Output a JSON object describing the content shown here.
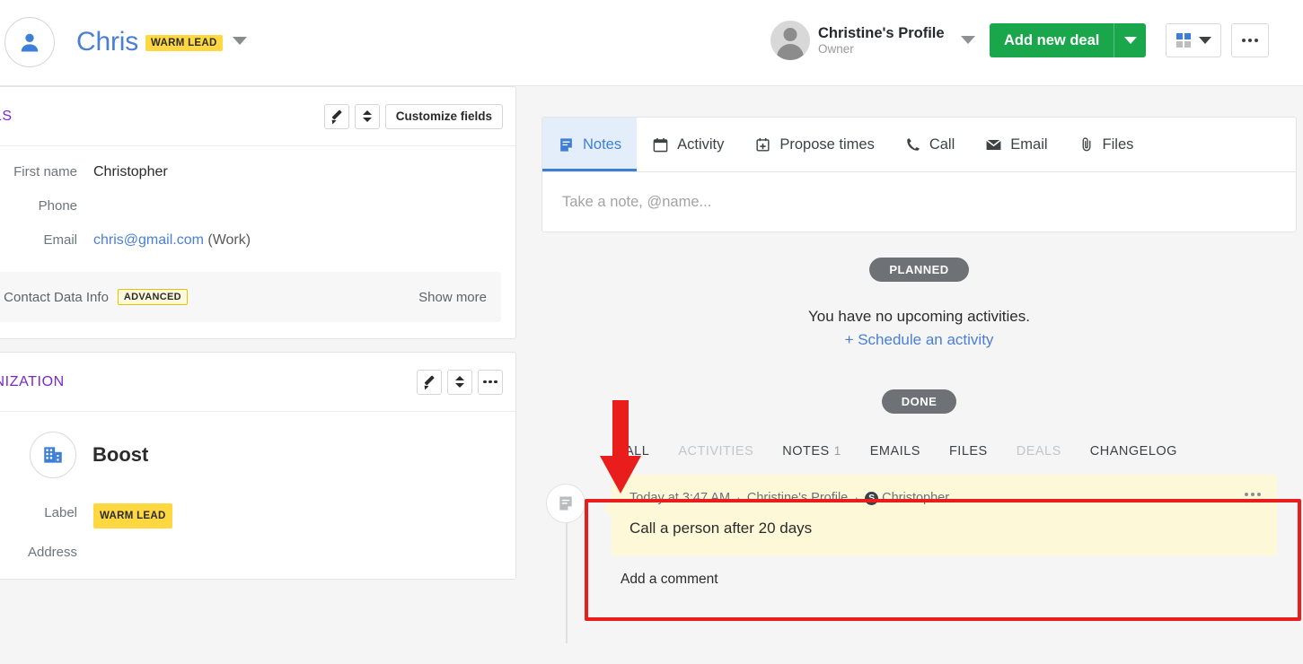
{
  "header": {
    "contact_name": "Chris",
    "contact_badge": "WARM LEAD",
    "owner_name": "Christine's Profile",
    "owner_role": "Owner",
    "add_deal_label": "Add new deal",
    "avatar_icon": "person-icon",
    "name_caret_icon": "chevron-down-icon",
    "owner_caret_icon": "chevron-down-icon",
    "grid_icon": "grid-view-icon",
    "more_icon": "ellipsis-icon"
  },
  "details_panel": {
    "title": "DETAILS",
    "customize_label": "Customize fields",
    "edit_icon": "pencil-icon",
    "reorder_icon": "sort-updown-icon",
    "fields": [
      {
        "label": "First name",
        "value": "Christopher",
        "type": "text"
      },
      {
        "label": "Phone",
        "value": "",
        "type": "text"
      },
      {
        "label": "Email",
        "value": "chris@gmail.com",
        "suffix": "(Work)",
        "type": "link"
      }
    ],
    "smart_data": {
      "text": "Smart Contact Data Info",
      "badge": "ADVANCED",
      "action": "Show more"
    }
  },
  "organization_panel": {
    "title": "ORGANIZATION",
    "edit_icon": "pencil-icon",
    "reorder_icon": "sort-updown-icon",
    "more_icon": "ellipsis-icon",
    "org_name": "Boost",
    "org_icon": "building-icon",
    "fields": [
      {
        "label": "Label",
        "value": "WARM LEAD",
        "type": "badge"
      },
      {
        "label": "Address",
        "value": "",
        "type": "text"
      }
    ]
  },
  "activity_panel": {
    "tabs": [
      {
        "label": "Notes",
        "icon": "note-icon",
        "active": true
      },
      {
        "label": "Activity",
        "icon": "calendar-icon",
        "active": false
      },
      {
        "label": "Propose times",
        "icon": "calendar-plus-icon",
        "active": false
      },
      {
        "label": "Call",
        "icon": "phone-icon",
        "active": false
      },
      {
        "label": "Email",
        "icon": "envelope-icon",
        "active": false
      },
      {
        "label": "Files",
        "icon": "paperclip-icon",
        "active": false
      }
    ],
    "note_placeholder": "Take a note, @name...",
    "note_value": "",
    "planned": {
      "pill": "PLANNED",
      "empty_text": "You have no upcoming activities.",
      "schedule_link": "+ Schedule an activity"
    },
    "done": {
      "pill": "DONE"
    },
    "filters": [
      {
        "label": "ALL",
        "count": "",
        "muted": false
      },
      {
        "label": "ACTIVITIES",
        "count": "",
        "muted": true
      },
      {
        "label": "NOTES",
        "count": "1",
        "muted": false
      },
      {
        "label": "EMAILS",
        "count": "",
        "muted": false
      },
      {
        "label": "FILES",
        "count": "",
        "muted": false
      },
      {
        "label": "DEALS",
        "count": "",
        "muted": true
      },
      {
        "label": "CHANGELOG",
        "count": "",
        "muted": false
      }
    ],
    "note_entry": {
      "icon": "note-icon",
      "timestamp": "Today at 3:47 AM",
      "author": "Christine's Profile",
      "deal_icon": "deal-dollar-icon",
      "deal_name": "Christopher",
      "body": "Call a person after 20 days",
      "more_icon": "ellipsis-icon",
      "comment_label": "Add a comment"
    }
  },
  "annotations": {
    "arrow_icon": "red-down-arrow",
    "arrow_color": "#ea1d1d",
    "highlight_color": "#ea1d1d"
  },
  "colors": {
    "accent_blue": "#3d7fd6",
    "link_blue": "#4a7fd4",
    "green": "#1aa64b",
    "badge_yellow": "#ffd740",
    "panel_title_purple": "#7a29c9",
    "note_yellow": "#fdf8d8",
    "pill_gray": "#6e7276"
  }
}
